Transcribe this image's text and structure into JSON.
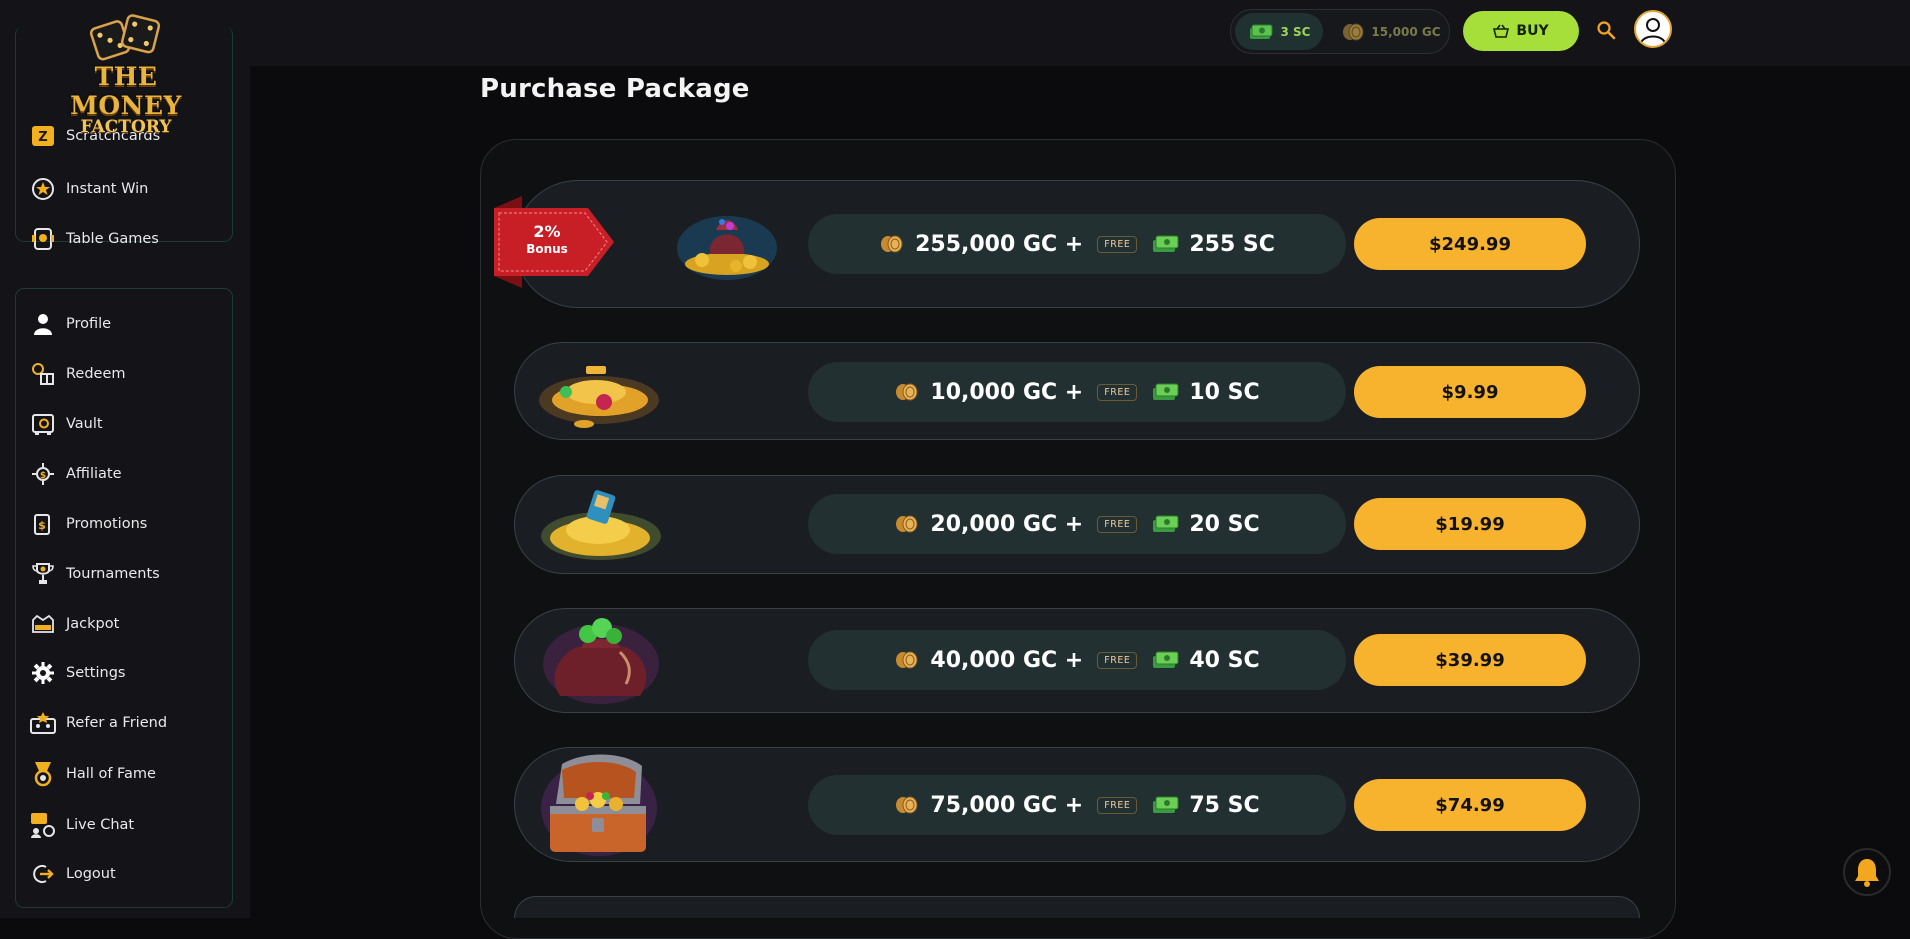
{
  "brand": {
    "line1": "THE MONEY",
    "line2": "FACTORY"
  },
  "header": {
    "sc_balance": "3 SC",
    "gc_balance": "15,000 GC",
    "buy_label": "BUY",
    "accent": "#a7df3a"
  },
  "sidebar": {
    "top_items": [
      {
        "label": "Scratchcards",
        "icon": "scratchcards-icon"
      },
      {
        "label": "Instant Win",
        "icon": "instant-win-icon"
      },
      {
        "label": "Table Games",
        "icon": "table-games-icon"
      }
    ],
    "items": [
      {
        "label": "Profile",
        "icon": "profile-icon"
      },
      {
        "label": "Redeem",
        "icon": "redeem-icon"
      },
      {
        "label": "Vault",
        "icon": "vault-icon"
      },
      {
        "label": "Affiliate",
        "icon": "affiliate-icon"
      },
      {
        "label": "Promotions",
        "icon": "promotions-icon"
      },
      {
        "label": "Tournaments",
        "icon": "trophy-icon"
      },
      {
        "label": "Jackpot",
        "icon": "jackpot-icon"
      },
      {
        "label": "Settings",
        "icon": "gear-icon"
      },
      {
        "label": "Refer a Friend",
        "icon": "refer-friend-icon"
      },
      {
        "label": "Hall of Fame",
        "icon": "medal-icon"
      },
      {
        "label": "Live Chat",
        "icon": "chat-icon"
      },
      {
        "label": "Logout",
        "icon": "logout-icon"
      }
    ]
  },
  "main": {
    "title": "Purchase Package",
    "bonus": {
      "percent": "2%",
      "label": "Bonus"
    },
    "free_label": "FREE",
    "packages": [
      {
        "gc": "255,000 GC +",
        "sc": "255 SC",
        "price": "$249.99"
      },
      {
        "gc": "10,000 GC +",
        "sc": "10 SC",
        "price": "$9.99"
      },
      {
        "gc": "20,000 GC +",
        "sc": "20 SC",
        "price": "$19.99"
      },
      {
        "gc": "40,000 GC +",
        "sc": "40 SC",
        "price": "$39.99"
      },
      {
        "gc": "75,000 GC +",
        "sc": "75 SC",
        "price": "$74.99"
      }
    ]
  },
  "colors": {
    "price_button": "#f7b22e",
    "row_bg": "#1a1e23",
    "info_pill": "#223032"
  }
}
